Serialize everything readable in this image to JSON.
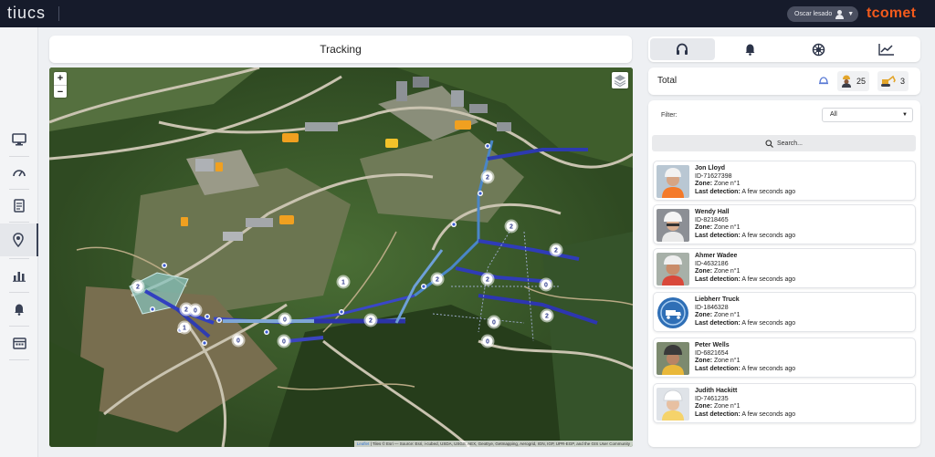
{
  "topbar": {
    "brand": "tiucs",
    "user_name": "Oscar lesado",
    "partner_logo": "tcomet",
    "colors": {
      "bar": "#161b2b",
      "partner": "#f25a1c"
    }
  },
  "rail": {
    "items": [
      {
        "icon": "monitor-icon",
        "active": false
      },
      {
        "icon": "dashboard-gauge-icon",
        "active": false
      },
      {
        "icon": "report-icon",
        "active": false
      },
      {
        "icon": "map-pin-icon",
        "active": true
      },
      {
        "icon": "bar-chart-icon",
        "active": false
      },
      {
        "icon": "bell-icon",
        "active": false
      },
      {
        "icon": "calendar-icon",
        "active": false
      }
    ]
  },
  "main": {
    "title": "Tracking",
    "map": {
      "zoom_in": "+",
      "zoom_out": "−",
      "attribution_lead": "Leaflet",
      "attribution": "| Tiles © Esri — Source: Esri, i-cubed, USDA, USGS, AEX, GeoEye, Getmapping, Aerogrid, IGN, IGP, UPR-EGP, and the GIS User Community",
      "clusters": [
        {
          "label": "2"
        },
        {
          "label": "2"
        },
        {
          "label": "2"
        },
        {
          "label": "2"
        },
        {
          "label": "2"
        },
        {
          "label": "2"
        },
        {
          "label": "0"
        },
        {
          "label": "0"
        },
        {
          "label": "0"
        },
        {
          "label": "1"
        },
        {
          "label": "2"
        },
        {
          "label": "0"
        },
        {
          "label": "0"
        },
        {
          "label": "0"
        },
        {
          "label": "2"
        },
        {
          "label": "1"
        },
        {
          "label": "0"
        },
        {
          "label": "2"
        }
      ]
    }
  },
  "panel": {
    "tabs": [
      {
        "icon": "headset-icon",
        "active": true
      },
      {
        "icon": "bell-icon",
        "active": false
      },
      {
        "icon": "wheel-icon",
        "active": false
      },
      {
        "icon": "line-chart-icon",
        "active": false
      }
    ],
    "total": {
      "label": "Total",
      "workers_count": "25",
      "machines_count": "3"
    },
    "filter": {
      "label": "Filter:",
      "value": "All"
    },
    "search": {
      "placeholder": "Search..."
    },
    "zone_label": "Zone:",
    "detection_label": "Last detection:",
    "entries": [
      {
        "name": "Jon Lloyd",
        "id": "ID-71627398",
        "zone": "Zone n°1",
        "detection": "A few seconds ago",
        "avatar": "worker-avatar"
      },
      {
        "name": "Wendy Hall",
        "id": "ID-8218465",
        "zone": "Zone n°1",
        "detection": "A few seconds ago",
        "avatar": "worker-avatar"
      },
      {
        "name": "Ahmer Wadee",
        "id": "ID-4632186",
        "zone": "Zone n°1",
        "detection": "A few seconds ago",
        "avatar": "worker-avatar"
      },
      {
        "name": "Liebherr Truck",
        "id": "ID-1846328",
        "zone": "Zone n°1",
        "detection": "A few seconds ago",
        "avatar": "truck-avatar"
      },
      {
        "name": "Peter Wells",
        "id": "ID-6821654",
        "zone": "Zone n°1",
        "detection": "A few seconds ago",
        "avatar": "worker-avatar"
      },
      {
        "name": "Judith Hackitt",
        "id": "ID-7461235",
        "zone": "Zone n°1",
        "detection": "A few seconds ago",
        "avatar": "worker-avatar"
      }
    ]
  }
}
